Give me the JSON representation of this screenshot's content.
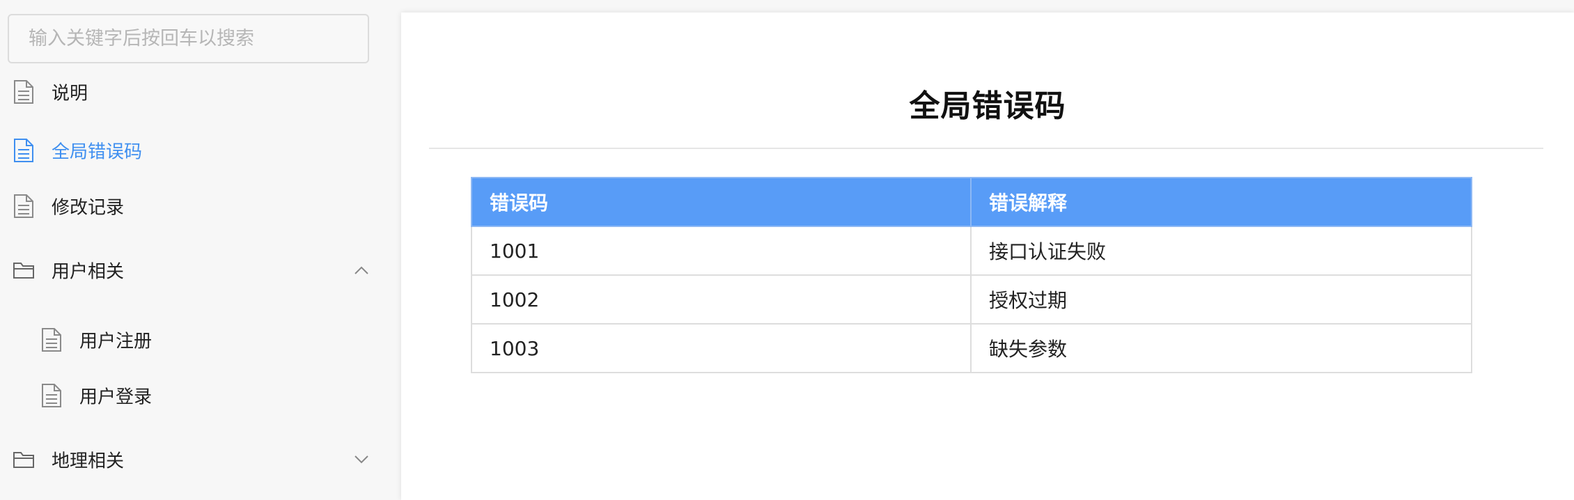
{
  "search": {
    "placeholder": "输入关键字后按回车以搜索",
    "value": ""
  },
  "sidebar": {
    "items": [
      {
        "label": "说明",
        "icon": "document-icon",
        "active": false
      },
      {
        "label": "全局错误码",
        "icon": "document-icon",
        "active": true
      },
      {
        "label": "修改记录",
        "icon": "document-icon",
        "active": false
      },
      {
        "label": "用户相关",
        "icon": "folder-icon",
        "expanded": true,
        "children": [
          {
            "label": "用户注册",
            "icon": "document-icon"
          },
          {
            "label": "用户登录",
            "icon": "document-icon"
          }
        ]
      },
      {
        "label": "地理相关",
        "icon": "folder-icon",
        "expanded": false
      }
    ]
  },
  "main": {
    "title": "全局错误码",
    "table": {
      "headers": [
        "错误码",
        "错误解释"
      ],
      "rows": [
        [
          "1001",
          "接口认证失败"
        ],
        [
          "1002",
          "授权过期"
        ],
        [
          "1003",
          "缺失参数"
        ]
      ]
    }
  },
  "colors": {
    "accent": "#3f8ff0",
    "table_header_bg": "#589cf7",
    "sidebar_bg": "#f7f7f7"
  }
}
